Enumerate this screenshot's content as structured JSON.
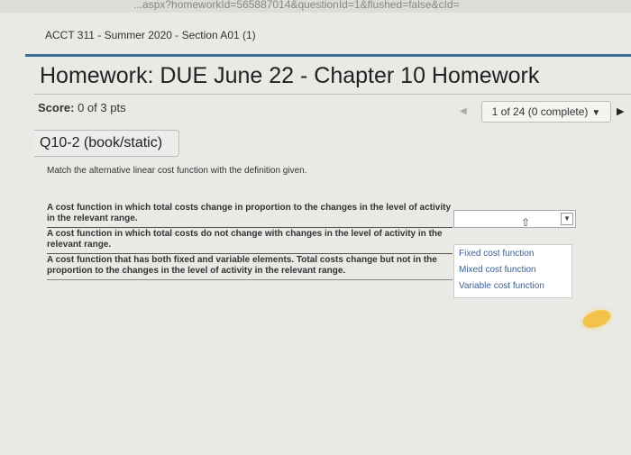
{
  "browser": {
    "url_fragment": "...aspx?homeworkId=565887014&questionId=1&flushed=false&cId="
  },
  "course": {
    "title": "ACCT 311 - Summer 2020 - Section A01 (1)"
  },
  "homework": {
    "title": "Homework: DUE June 22 - Chapter 10 Homework"
  },
  "score": {
    "label": "Score:",
    "value": "0 of 3 pts"
  },
  "nav": {
    "prev_icon": "◀",
    "position": "1 of 24 (0 complete)",
    "caret": "▼",
    "next_icon": "▶"
  },
  "question": {
    "id": "Q10-2 (book/static)",
    "instruction": "Match the alternative linear cost function with the definition given.",
    "statements": [
      "A cost function in which total costs change in proportion to the changes in the level of activity in the relevant range.",
      "A cost function in which total costs do not change with changes in the level of activity in the relevant range.",
      "A cost function that has both fixed and variable elements. Total costs change but not in the proportion to the changes in the level of activity in the relevant range."
    ]
  },
  "select": {
    "current_value": "",
    "arrow": "▼"
  },
  "options": [
    "Fixed cost function",
    "Mixed cost function",
    "Variable cost function"
  ],
  "colors": {
    "accent_rule": "#3d6e9c",
    "option_text": "#3a5f8f",
    "glare": "#f3c24a"
  }
}
